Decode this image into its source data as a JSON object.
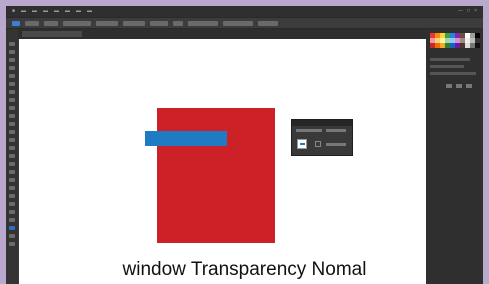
{
  "caption": "window  Transparency Nomal",
  "colors": {
    "frame": "#b9a9cf",
    "red_shape": "#cc2127",
    "blue_bar": "#1f7bc4",
    "canvas": "#ffffff"
  },
  "icons": [
    "app-logo-icon",
    "color-swatch-icon",
    "transparency-thumbnail-icon",
    "mask-icon"
  ]
}
